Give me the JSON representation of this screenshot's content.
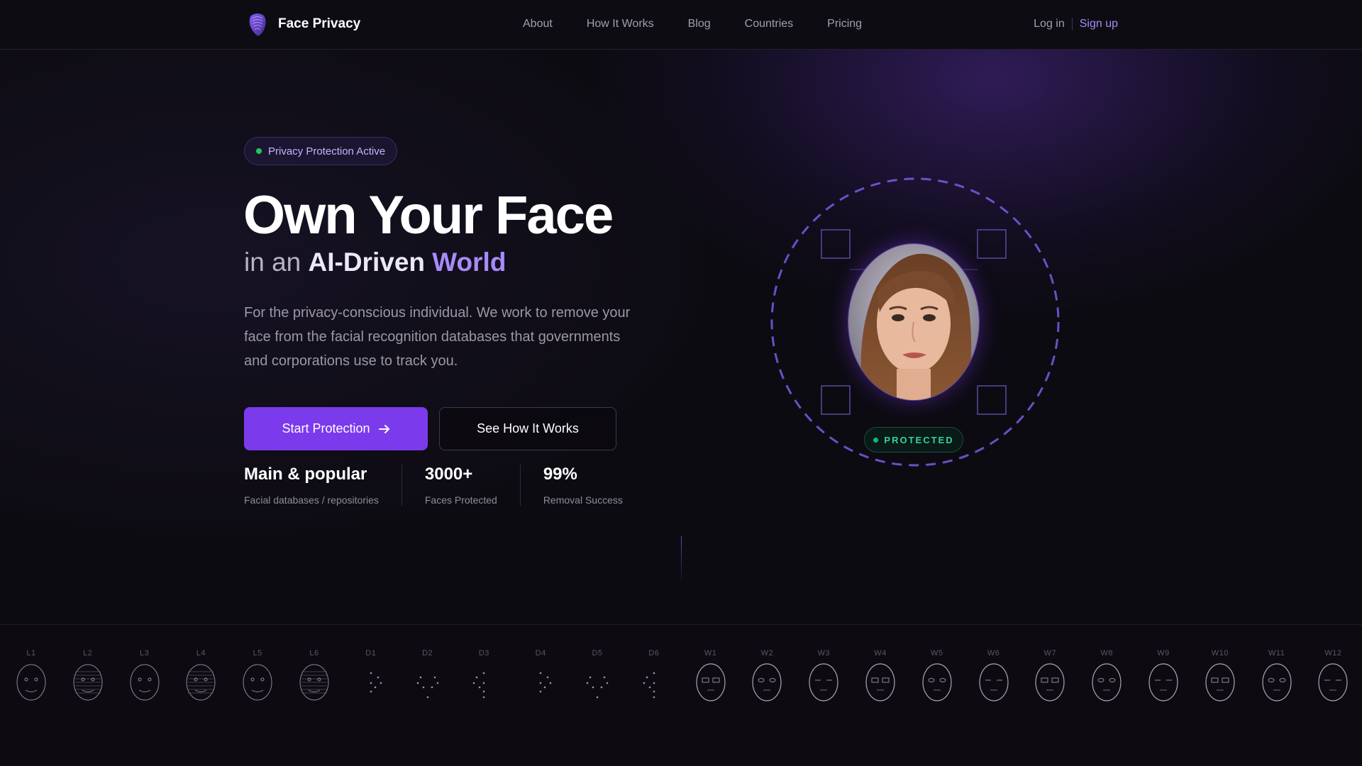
{
  "brand": {
    "name": "Face Privacy",
    "icon": "fingerprint-head-icon"
  },
  "nav": {
    "items": [
      "About",
      "How It Works",
      "Blog",
      "Countries",
      "Pricing"
    ]
  },
  "auth": {
    "login": "Log in",
    "signup": "Sign up"
  },
  "hero": {
    "badge": "Privacy Protection Active",
    "title": "Own Your Face",
    "subtitle_prefix": "in an",
    "subtitle_highlight": "AI-Driven",
    "subtitle_accent": "World",
    "description": "For the privacy-conscious individual. We work to remove your face from the facial recognition databases that governments and corporations use to track you.",
    "primary_cta": "Start Protection",
    "secondary_cta": "See How It Works",
    "stats": [
      {
        "value": "Main & popular",
        "label": "Facial databases / repositories"
      },
      {
        "value": "3000+",
        "label": "Faces Protected"
      },
      {
        "value": "99%",
        "label": "Removal Success"
      }
    ],
    "status_badge": "PROTECTED"
  },
  "strip": {
    "labels": [
      "L1",
      "L2",
      "L3",
      "L4",
      "L5",
      "L6",
      "D1",
      "D2",
      "D3",
      "D4",
      "D5",
      "D6",
      "W1",
      "W2",
      "W3",
      "W4",
      "W5",
      "W6",
      "W7",
      "W8",
      "W9",
      "W10",
      "W11",
      "W12"
    ]
  },
  "colors": {
    "accent": "#7c3aed",
    "accent_light": "#a78bfa",
    "success": "#22c55e",
    "background": "#0d0b12"
  }
}
